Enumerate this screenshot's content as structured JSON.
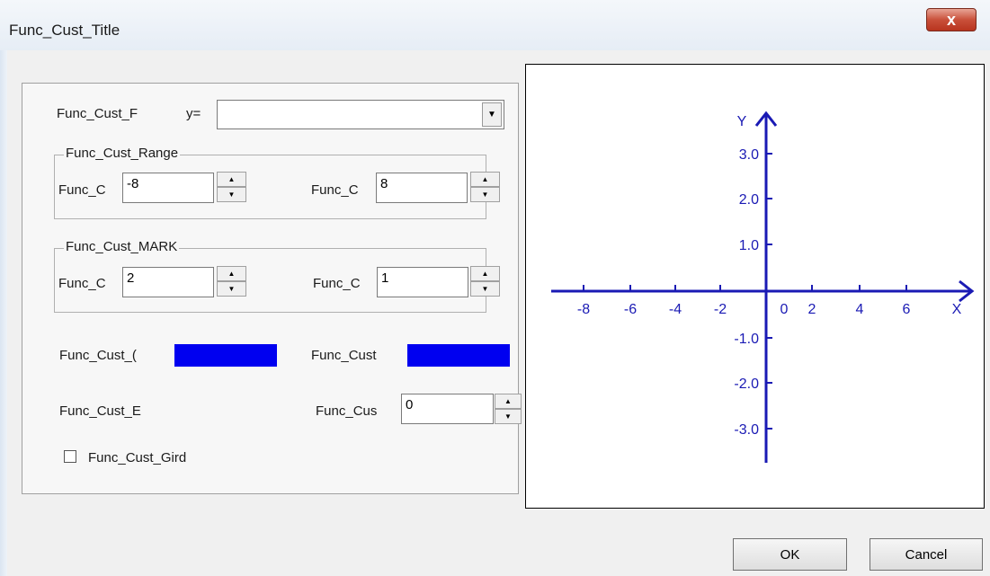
{
  "window": {
    "title": "Func_Cust_Title",
    "close_label": "x"
  },
  "expression": {
    "label": "Func_Cust_F",
    "y_label": "y=",
    "value": "",
    "dropdown_glyph": "▼"
  },
  "range": {
    "group_label": "Func_Cust_Range",
    "min_label": "Func_C",
    "min_value": "-8",
    "max_label": "Func_C",
    "max_value": "8"
  },
  "mark": {
    "group_label": "Func_Cust_MARK",
    "x_label": "Func_C",
    "x_value": "2",
    "y_label": "Func_C",
    "y_value": "1"
  },
  "colors": {
    "curve_label": "Func_Cust_(",
    "curve_color": "#0000f0",
    "axis_label": "Func_Cust",
    "axis_color": "#0000f0"
  },
  "extra": {
    "left_label": "Func_Cust_E",
    "right_label": "Func_Cus",
    "right_value": "0"
  },
  "grid": {
    "label": "Func_Cust_Gird",
    "checked": false
  },
  "spin_up": "▲",
  "spin_down": "▼",
  "preview": {
    "axis_color": "#1a1ab4",
    "x_axis_label": "X",
    "y_axis_label": "Y",
    "x_ticks": [
      "-8",
      "-6",
      "-4",
      "-2",
      "0",
      "2",
      "4",
      "6"
    ],
    "y_ticks": [
      "3.0",
      "2.0",
      "1.0",
      "-1.0",
      "-2.0",
      "-3.0"
    ]
  },
  "buttons": {
    "ok": "OK",
    "cancel": "Cancel"
  }
}
